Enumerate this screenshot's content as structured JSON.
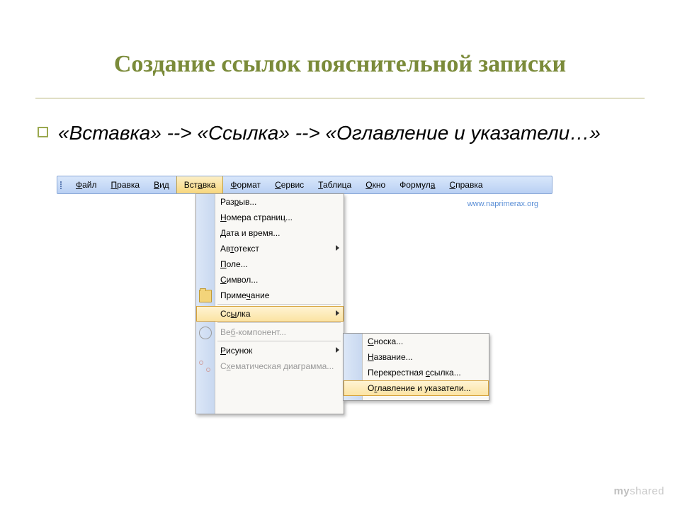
{
  "title": "Создание ссылок пояснительной записки",
  "bullet": "«Вставка» --> «Ссылка» --> «Оглавление и указатели…»",
  "watermark": "www.naprimerax.org",
  "myshared": {
    "a": "my",
    "b": "shared"
  },
  "menubar": {
    "items": [
      {
        "label": "Файл",
        "u": "Ф"
      },
      {
        "label": "Правка",
        "u": "П"
      },
      {
        "label": "Вид",
        "u": "В"
      },
      {
        "label": "Вставка",
        "u": "а",
        "open": true
      },
      {
        "label": "Формат",
        "u": "Ф"
      },
      {
        "label": "Сервис",
        "u": "С"
      },
      {
        "label": "Таблица",
        "u": "Т"
      },
      {
        "label": "Окно",
        "u": "О"
      },
      {
        "label": "Формула",
        "u": "а"
      },
      {
        "label": "Справка",
        "u": "С"
      }
    ]
  },
  "menu1": {
    "items": [
      {
        "label": "Разрыв..."
      },
      {
        "label": "Номера страниц..."
      },
      {
        "label": "Дата и время..."
      },
      {
        "label": "Автотекст",
        "submenu": true
      },
      {
        "label": "Поле..."
      },
      {
        "label": "Символ..."
      },
      {
        "label": "Примечание",
        "icon": "folder"
      },
      {
        "sep": true
      },
      {
        "label": "Ссылка",
        "submenu": true,
        "highlight": true
      },
      {
        "sep": true
      },
      {
        "label": "Веб-компонент...",
        "icon": "globe",
        "disabled": true
      },
      {
        "sep": true
      },
      {
        "label": "Рисунок",
        "submenu": true
      },
      {
        "label": "Схематическая диаграмма...",
        "icon": "diagram",
        "disabled": true
      }
    ]
  },
  "menu2": {
    "items": [
      {
        "label": "Сноска..."
      },
      {
        "label": "Название..."
      },
      {
        "label": "Перекрестная ссылка..."
      },
      {
        "label": "Оглавление и указатели...",
        "highlight": true
      }
    ]
  }
}
